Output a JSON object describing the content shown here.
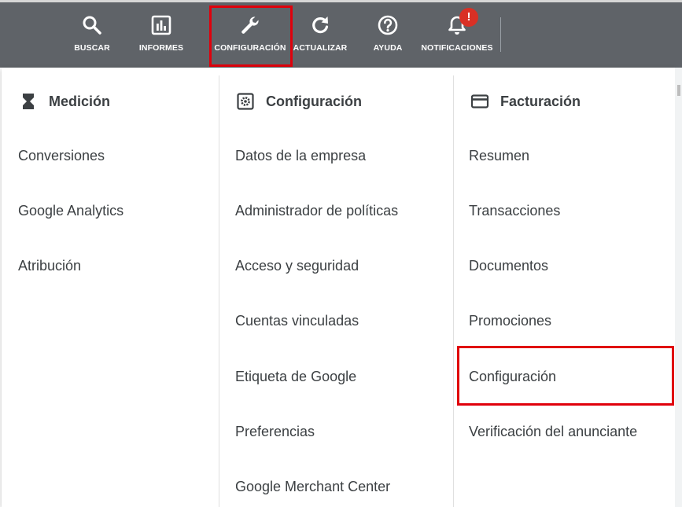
{
  "toolbar": {
    "items": [
      {
        "label": "BUSCAR",
        "icon": "search-icon"
      },
      {
        "label": "INFORMES",
        "icon": "bar-chart-icon"
      },
      {
        "label": "CONFIGURACIÓN",
        "icon": "wrench-icon"
      },
      {
        "label": "ACTUALIZAR",
        "icon": "refresh-icon"
      },
      {
        "label": "AYUDA",
        "icon": "help-icon"
      },
      {
        "label": "NOTIFICACIONES",
        "icon": "bell-icon"
      }
    ],
    "notification_badge": "!"
  },
  "columns": {
    "measurement": {
      "title": "Medición",
      "icon": "hourglass-icon",
      "items": [
        "Conversiones",
        "Google Analytics",
        "Atribución"
      ]
    },
    "setup": {
      "title": "Configuración",
      "icon": "settings-box-icon",
      "items": [
        "Datos de la empresa",
        "Administrador de políticas",
        "Acceso y seguridad",
        "Cuentas vinculadas",
        "Etiqueta de Google",
        "Preferencias",
        "Google Merchant Center"
      ]
    },
    "billing": {
      "title": "Facturación",
      "icon": "credit-card-icon",
      "items": [
        "Resumen",
        "Transacciones",
        "Documentos",
        "Promociones",
        "Configuración",
        "Verificación del anunciante"
      ]
    }
  },
  "colors": {
    "toolbar_bg": "#5f6368",
    "highlight": "#e0000b",
    "badge": "#d93025",
    "text": "#3c4043"
  }
}
